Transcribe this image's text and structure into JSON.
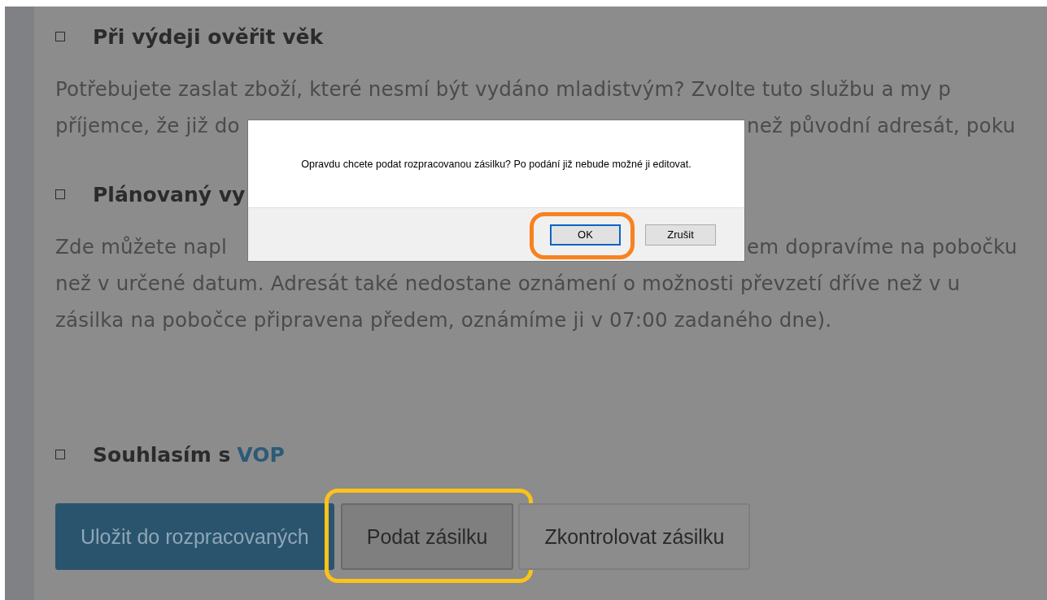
{
  "sections": [
    {
      "checked": false,
      "title": "Při výdeji ověřit věk",
      "lines": [
        {
          "left": "Potřebujete zaslat zboží, které nesmí být vydáno mladistvým? Zvolte tuto službu a my p"
        },
        {
          "left": "příjemce, že již do",
          "right": "než původní adresát, poku"
        }
      ]
    },
    {
      "checked": false,
      "title": "Plánovaný vy",
      "lines": [
        {
          "left": "Zde můžete napl",
          "right": "em dopravíme na pobočku"
        },
        {
          "left": "než v určené datum. Adresát také nedostane oznámení o možnosti převzetí dříve než v u"
        },
        {
          "left": "zásilka na pobočce připravena předem, oznámíme ji v 07:00 zadaného dne)."
        }
      ]
    }
  ],
  "consent": {
    "checked": false,
    "label": "Souhlasím s",
    "link": "VOP"
  },
  "buttons": [
    {
      "label": "Uložit do rozpracovaných",
      "kind": "primary",
      "highlighted": false
    },
    {
      "label": "Podat zásilku",
      "kind": "pressed",
      "highlighted": true
    },
    {
      "label": "Zkontrolovat zásilku",
      "kind": "outline",
      "highlighted": false
    }
  ],
  "dialog": {
    "message": "Opravdu chcete podat rozpracovanou zásilku? Po podání již nebude možné ji editovat.",
    "buttons": [
      {
        "label": "OK",
        "focused": true,
        "highlighted": true
      },
      {
        "label": "Zrušit",
        "focused": false,
        "highlighted": false
      }
    ]
  }
}
